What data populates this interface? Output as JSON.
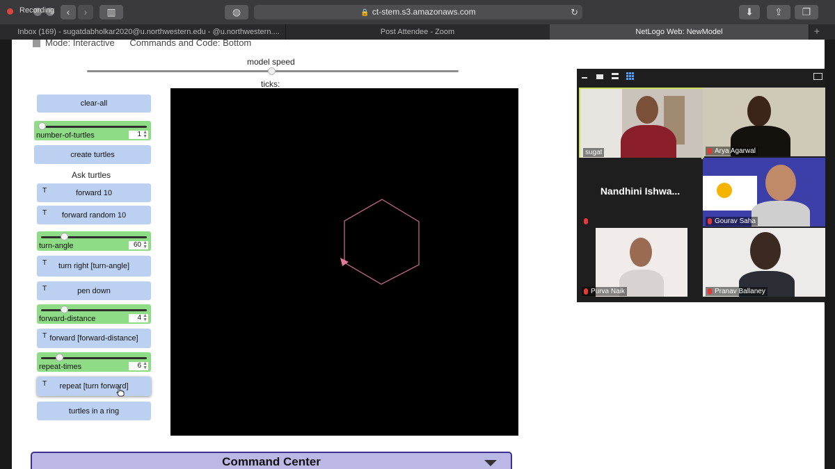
{
  "browser": {
    "recording_label": "Recording",
    "url": "ct-stem.s3.amazonaws.com",
    "tabs": [
      {
        "label": "Inbox (169) - sugatdabholkar2020@u.northwestern.edu - @u.northwestern...."
      },
      {
        "label": "Post Attendee - Zoom"
      },
      {
        "label": "NetLogo Web: NewModel"
      }
    ],
    "new_tab": "+"
  },
  "netlogo": {
    "mode_line": "Mode: Interactive      Commands and Code: Bottom",
    "speed_label": "model speed",
    "speed_level": 0.5,
    "ticks_label": "ticks:",
    "buttons": {
      "clear_all": "clear-all",
      "create_turtles": "create turtles",
      "forward_10": "forward 10",
      "forward_random_10": "forward random 10",
      "turn_right": "turn right [turn-angle]",
      "pen_down": "pen down",
      "forward_distance": "forward [forward-distance]",
      "repeat": "repeat [turn forward]",
      "ring": "turtles in a ring",
      "turtle_marker": "T"
    },
    "ask_label": "Ask turtles",
    "sliders": [
      {
        "name": "number-of-turtles",
        "value": "1",
        "level": 0.0
      },
      {
        "name": "turn-angle",
        "value": "60",
        "level": 0.2
      },
      {
        "name": "forward-distance",
        "value": "4",
        "level": 0.2
      },
      {
        "name": "repeat-times",
        "value": "6",
        "level": 0.15
      }
    ],
    "command_center": "Command Center",
    "drawing": {
      "shape": "hexagon",
      "sides": 6,
      "color": "#c06a86"
    }
  },
  "zoom": {
    "participants": [
      {
        "name": "sugat",
        "muted": false,
        "highlighted": true
      },
      {
        "name": "Arya Agarwal",
        "muted": true
      },
      {
        "name": "Nandhini  Ishwa...",
        "muted": true,
        "video": false
      },
      {
        "name": "Gourav Saha",
        "muted": true
      },
      {
        "name": "Purva Naik",
        "muted": true
      },
      {
        "name": "Pranav Ballaney",
        "muted": true
      }
    ],
    "active_view_color": "#4fa3ff"
  }
}
